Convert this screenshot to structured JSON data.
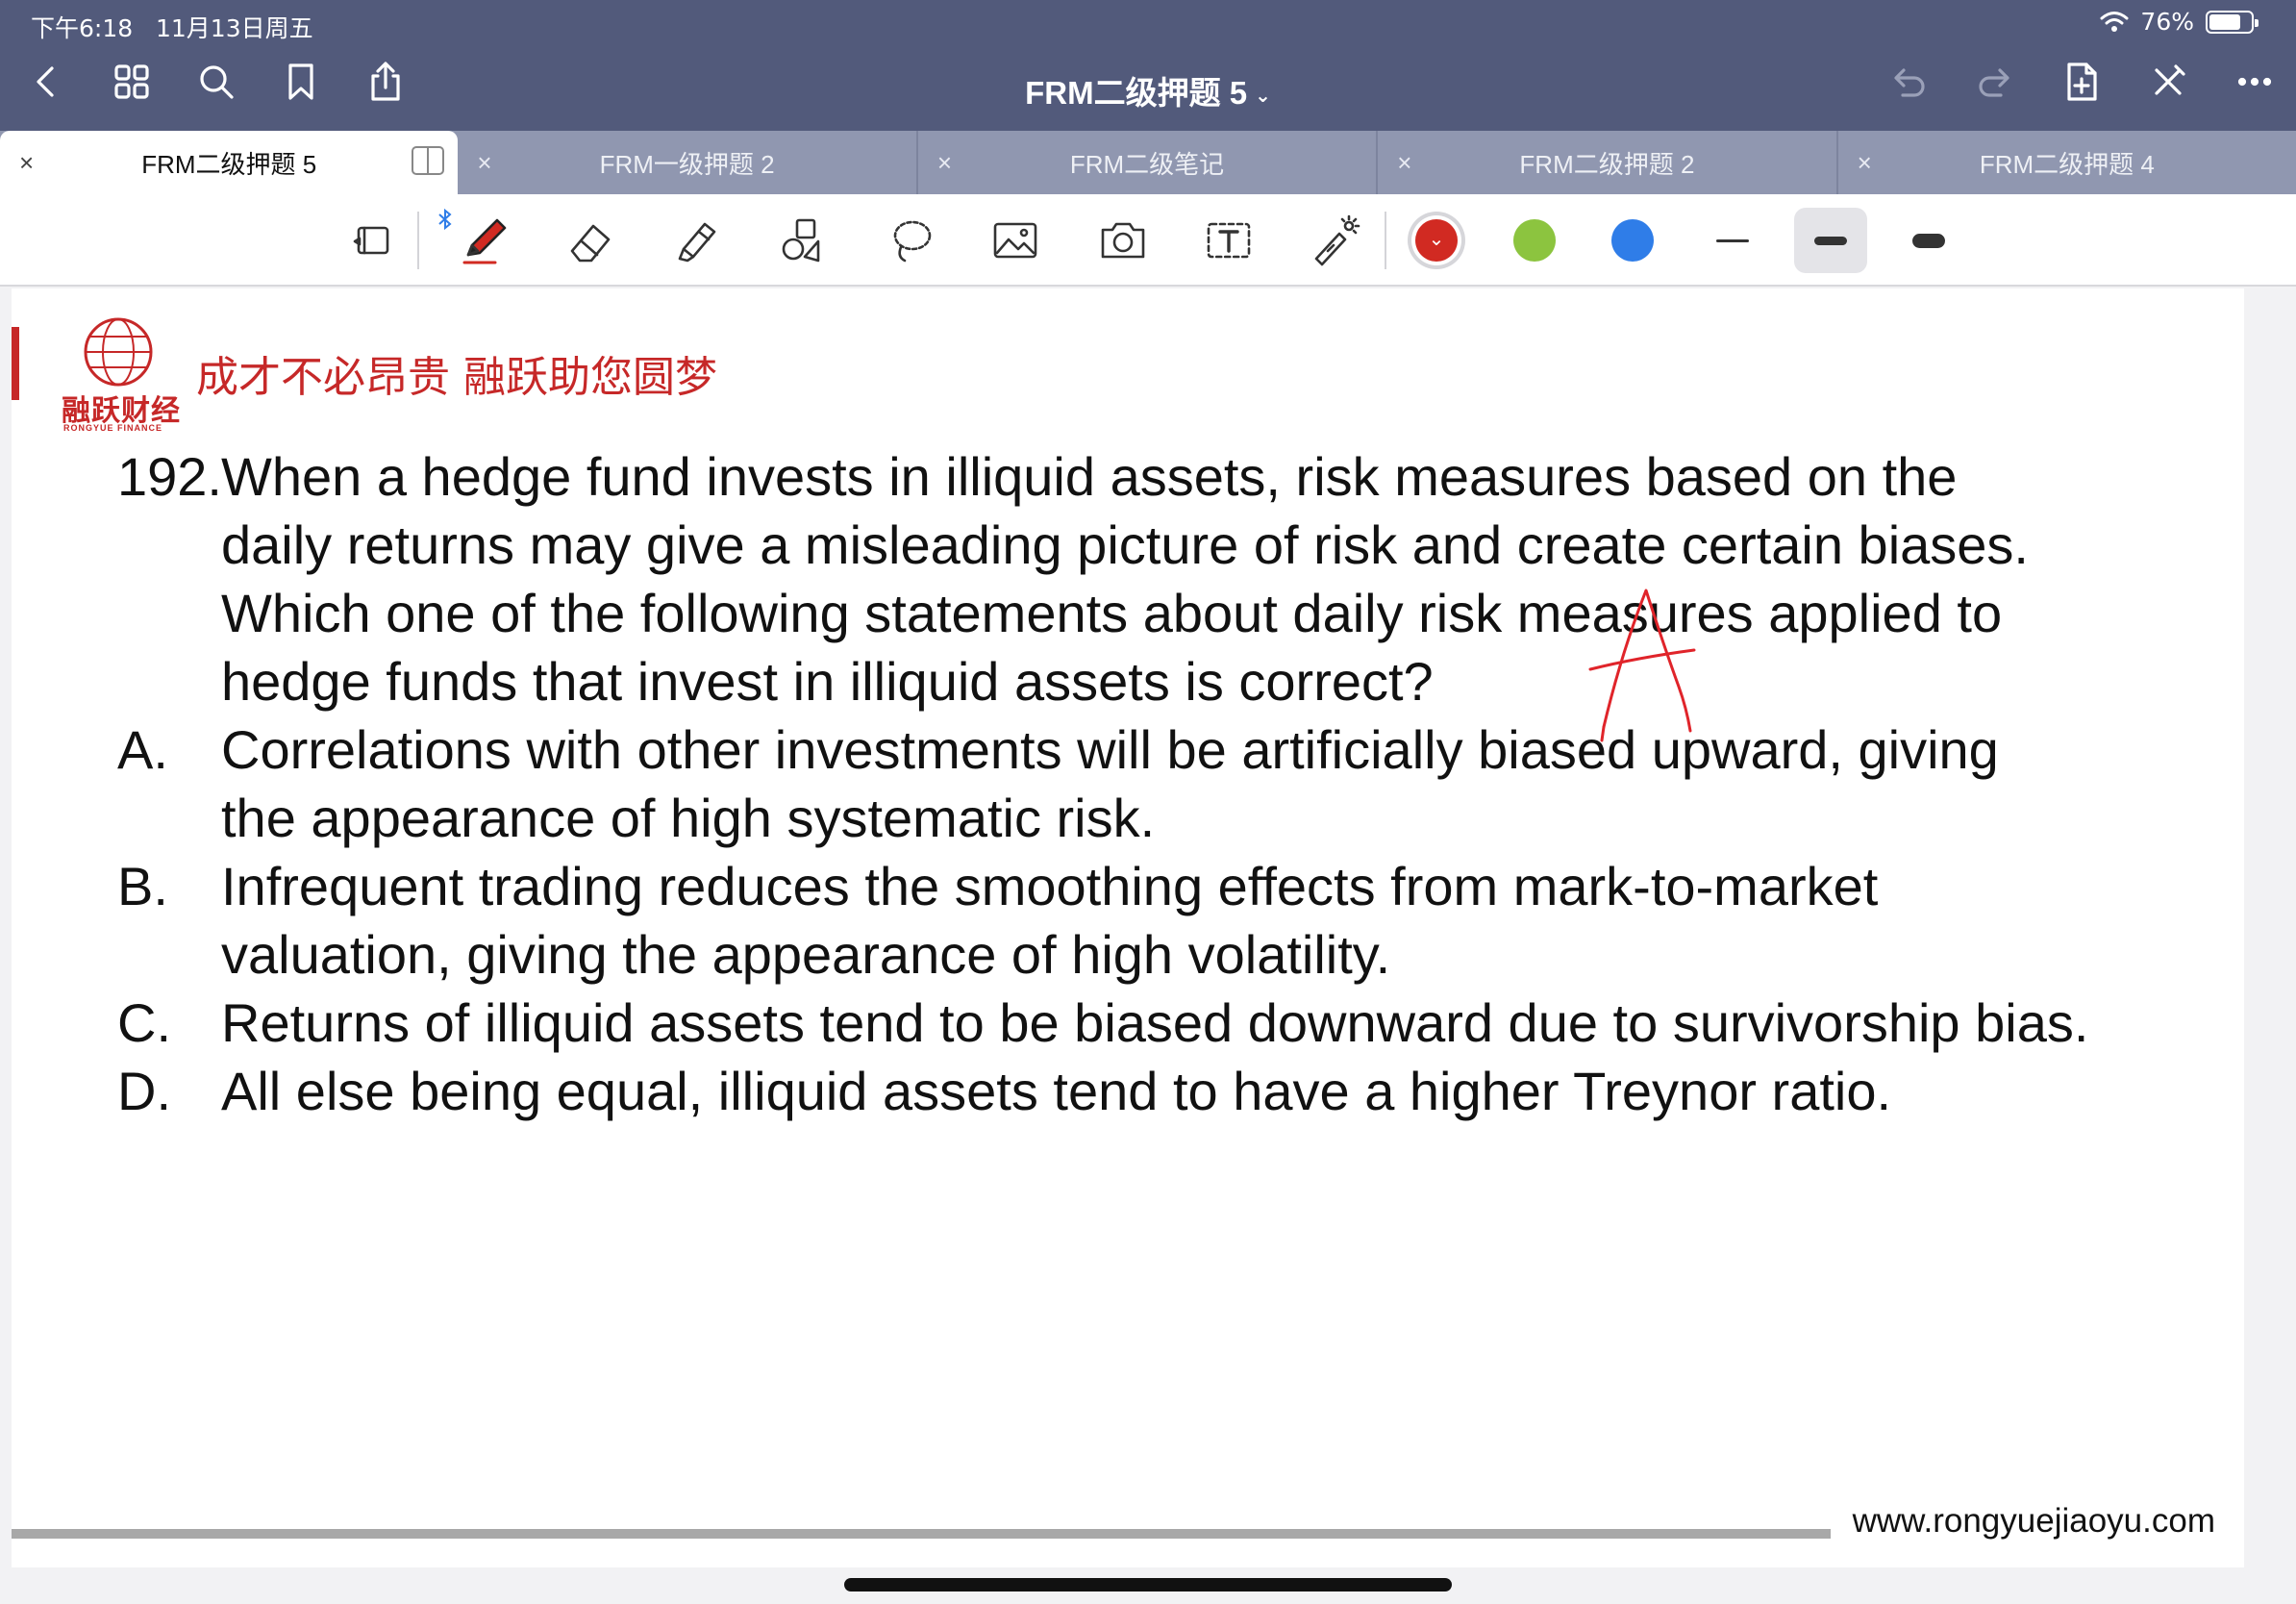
{
  "status_bar": {
    "time": "下午6:18",
    "date": "11月13日周五",
    "battery": "76%",
    "battery_level": 0.76
  },
  "title_bar": {
    "doc_title": "FRM二级押题 5",
    "left_icons": [
      "back-chevron-icon",
      "grid-icon",
      "search-icon",
      "bookmark-icon",
      "share-icon"
    ],
    "right_icons": [
      "undo-icon",
      "redo-icon",
      "add-page-icon",
      "close-icon",
      "more-icon"
    ]
  },
  "tabs": [
    {
      "label": "FRM二级押题 5",
      "active": true
    },
    {
      "label": "FRM一级押题 2",
      "active": false
    },
    {
      "label": "FRM二级笔记",
      "active": false
    },
    {
      "label": "FRM二级押题 2",
      "active": false
    },
    {
      "label": "FRM二级押题 4",
      "active": false
    }
  ],
  "toolbar": {
    "tools": [
      "read-mode-icon",
      "pen-icon",
      "eraser-icon",
      "highlighter-icon",
      "shapes-icon",
      "lasso-icon",
      "image-icon",
      "camera-icon",
      "text-icon",
      "laser-pointer-icon"
    ],
    "selected_tool": "pen-icon",
    "colors": [
      "#d12a22",
      "#8cc43f",
      "#2f7de8"
    ],
    "selected_color": "#d12a22",
    "stroke_widths": [
      "thin",
      "medium",
      "thick"
    ],
    "selected_stroke": "medium"
  },
  "page": {
    "logo_cn": "融跃财经",
    "logo_en": "RONGYUE FINANCE",
    "slogan": "成才不必昂贵 融跃助您圆梦",
    "question_number": "192.",
    "question_lines": [
      "When a hedge fund invests in illiquid assets, risk measures based on the",
      "daily returns may give a misleading picture of risk and create certain biases.",
      "Which one of the following statements about daily risk measures applied to",
      "hedge funds that invest in illiquid assets is correct?"
    ],
    "options": [
      {
        "letter": "A.",
        "lines": [
          "Correlations with other investments will be artificially biased upward, giving",
          "the appearance of high systematic risk."
        ]
      },
      {
        "letter": "B.",
        "lines": [
          "Infrequent trading reduces the smoothing effects from mark-to-market",
          "valuation, giving the appearance of high volatility."
        ]
      },
      {
        "letter": "C.",
        "lines": [
          "Returns of illiquid assets tend to be biased downward due to survivorship bias."
        ]
      },
      {
        "letter": "D.",
        "lines": [
          "All else being equal, illiquid assets tend to have a higher Treynor ratio."
        ]
      }
    ],
    "handwritten_answer": "A",
    "ink_color": "#e0242a",
    "footer_url": "www.rongyuejiaoyu.com"
  }
}
